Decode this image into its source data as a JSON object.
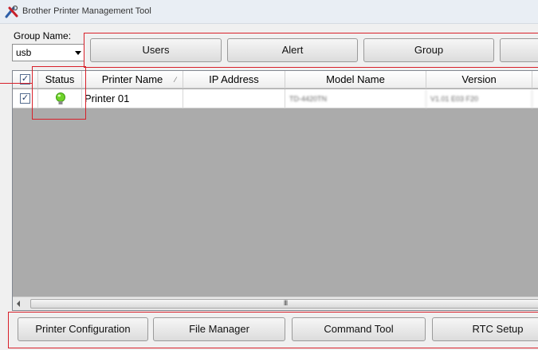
{
  "window": {
    "title": "Brother Printer Management Tool",
    "icon": "brother-tool-icon"
  },
  "group": {
    "label": "Group Name:",
    "selected": "usb"
  },
  "toolbar": {
    "users_label": "Users",
    "alert_label": "Alert",
    "group_label": "Group"
  },
  "table": {
    "columns": [
      "Status",
      "Printer Name",
      "IP Address",
      "Model Name",
      "Version"
    ],
    "header_checked": "✓",
    "rows": [
      {
        "checked": "✓",
        "status": "online",
        "printer_name": "Printer 01",
        "ip_address": "",
        "model_name": "TD-4420TN",
        "version": "V1.01 E03 F20"
      }
    ]
  },
  "scrollbar": {
    "grip": "III"
  },
  "bottom_buttons": {
    "printer_config": "Printer Configuration",
    "file_manager": "File Manager",
    "command_tool": "Command Tool",
    "rtc_setup": "RTC Setup"
  },
  "colors": {
    "highlight": "#d8202a",
    "grid_bg": "#ababab",
    "status_online": "#6fd32a"
  }
}
